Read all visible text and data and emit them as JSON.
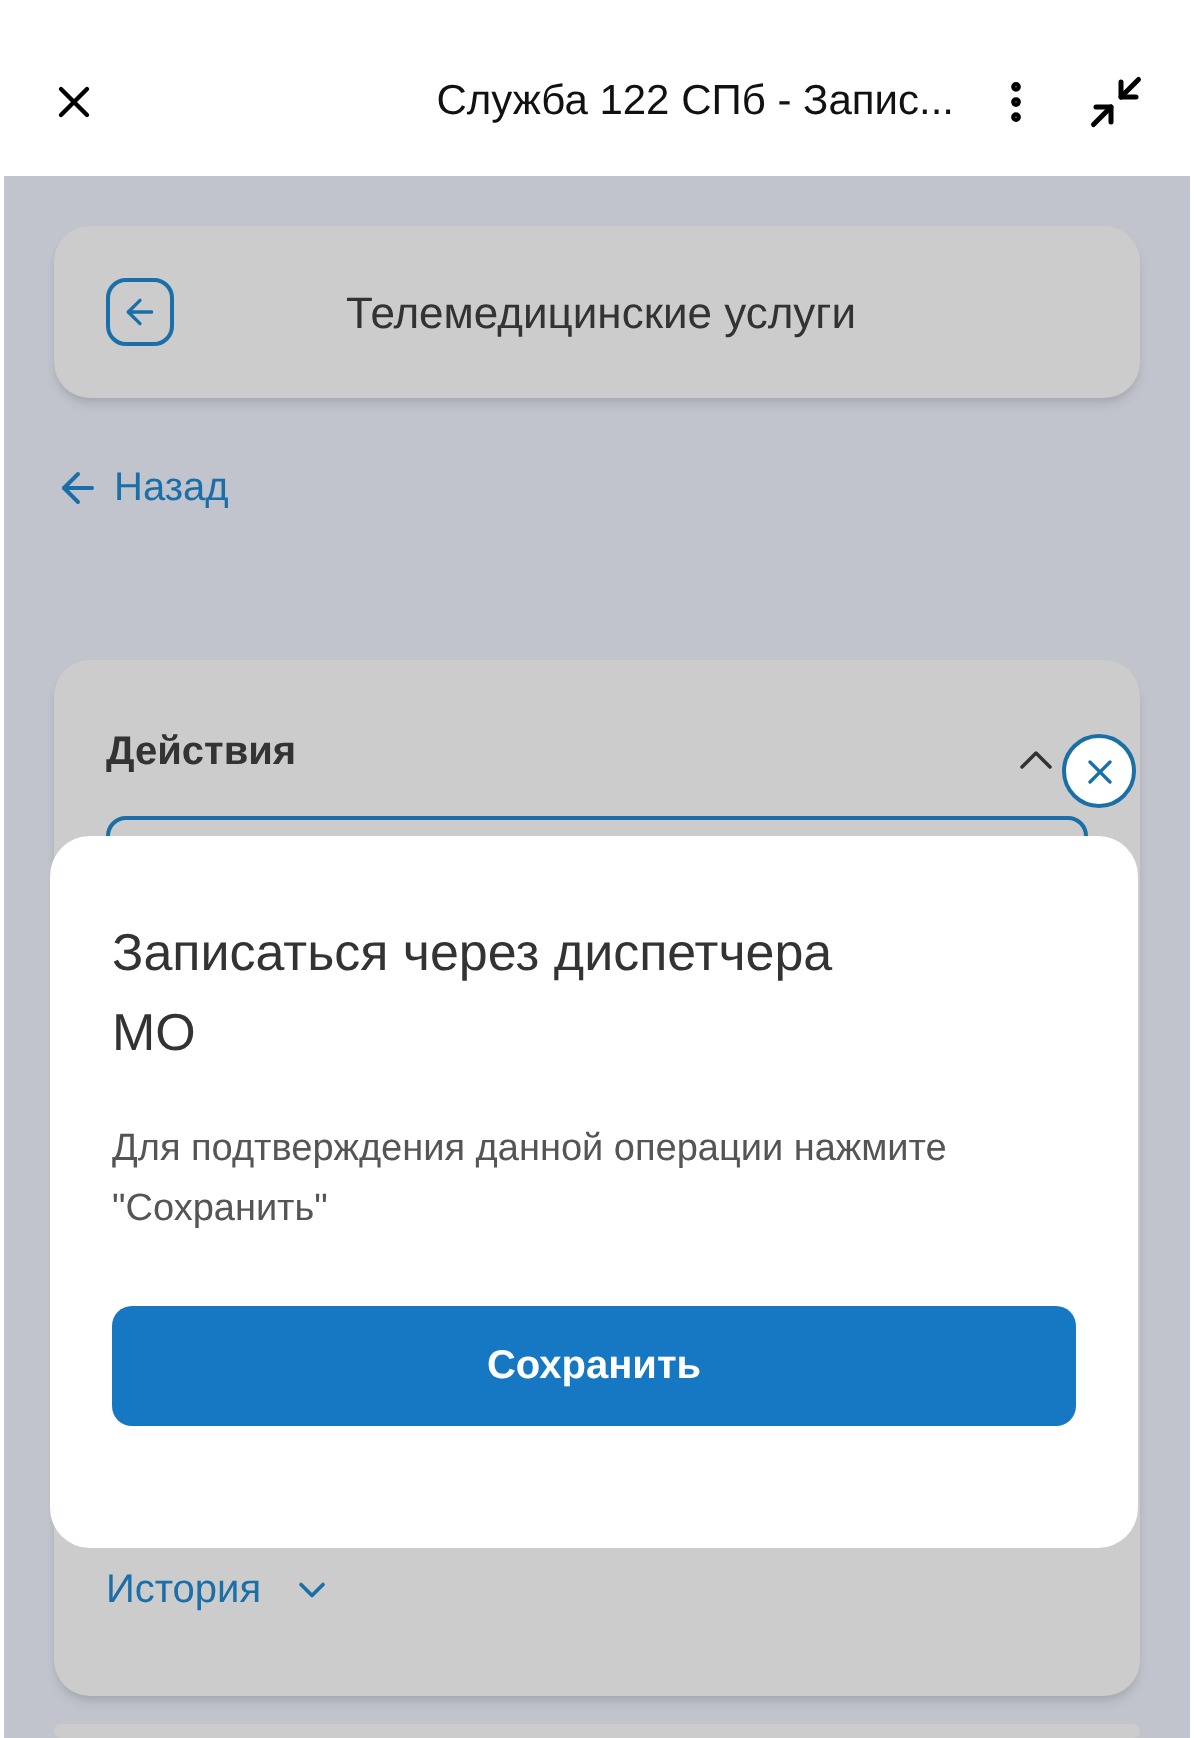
{
  "window": {
    "title": "Служба 122 СПб - Запис..."
  },
  "header": {
    "title": "Телемедицинские услуги"
  },
  "back_link": "Назад",
  "sections": [
    {
      "title": "Действия",
      "expanded": true
    },
    {
      "title": "История",
      "expanded": false
    }
  ],
  "dialog": {
    "title": "Записаться через диспетчера МО",
    "message": "Для подтверждения данной операции нажмите \"Сохранить\"",
    "button": "Сохранить"
  }
}
